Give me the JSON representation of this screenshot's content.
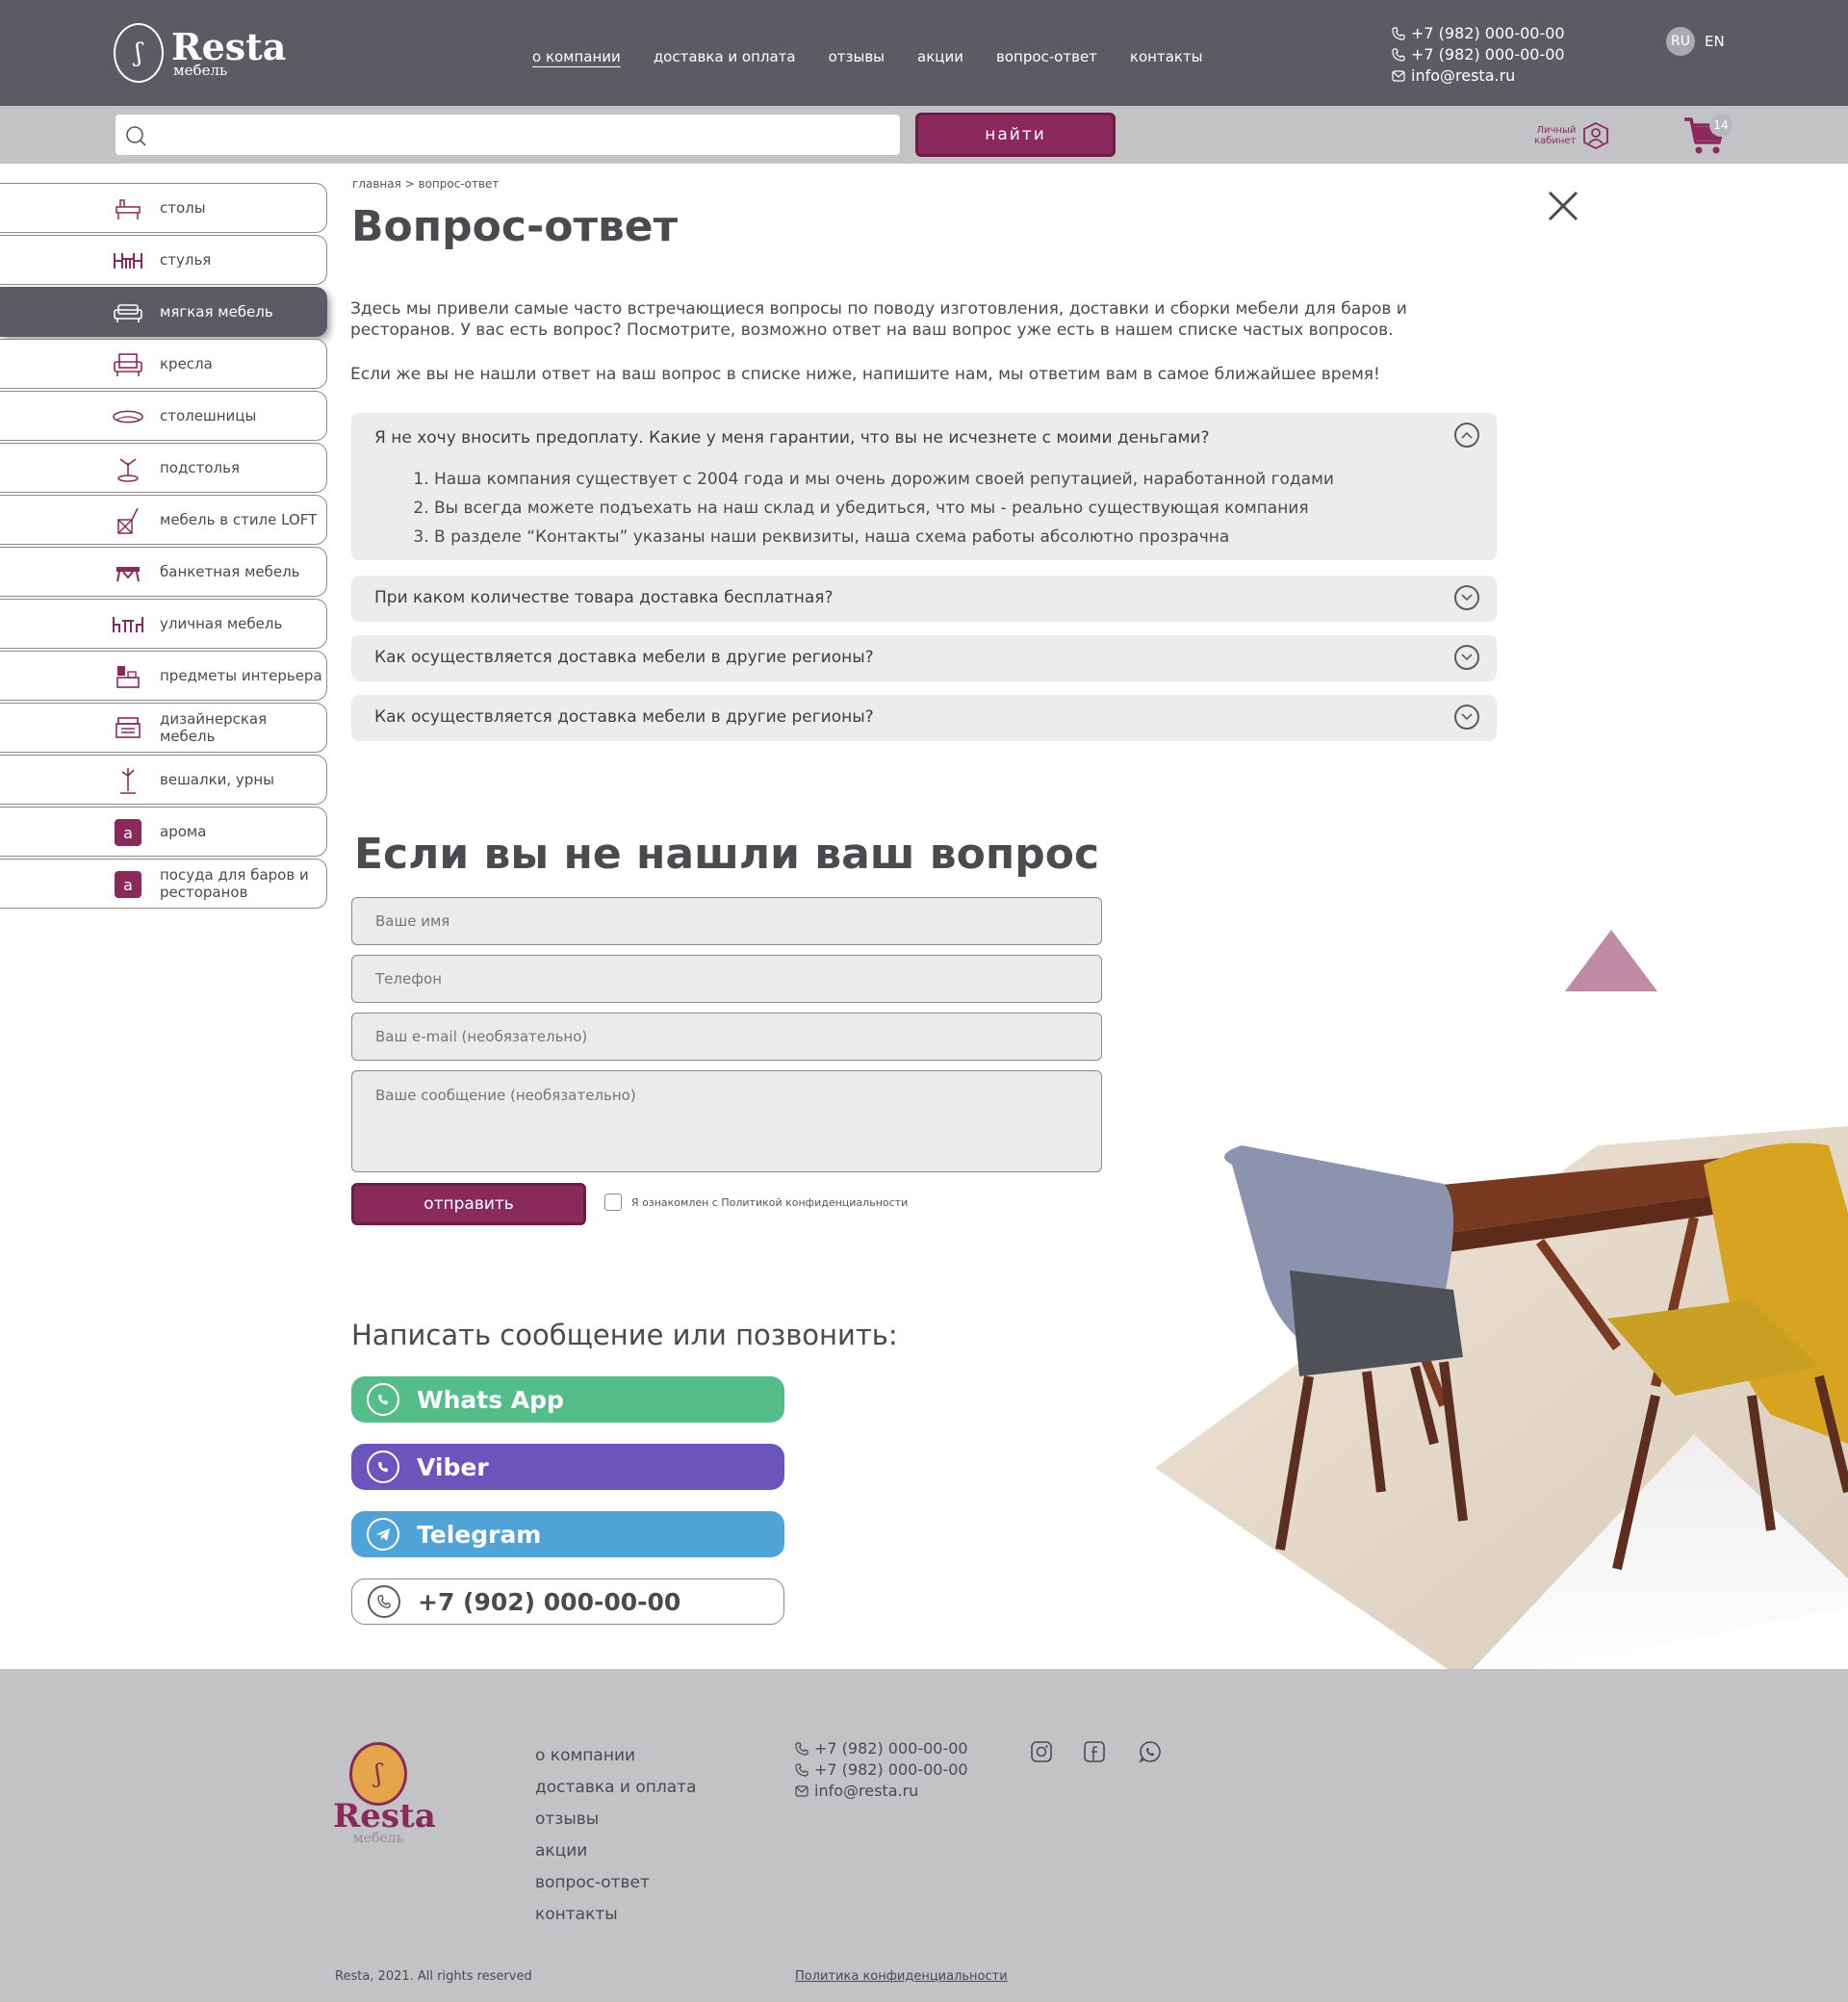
{
  "header": {
    "logo_name": "Resta",
    "logo_sub": "мебель",
    "nav": [
      "о компании",
      "доставка и оплата",
      "отзывы",
      "акции",
      "вопрос-ответ",
      "контакты"
    ],
    "phone1": "+7 (982) 000-00-00",
    "phone2": "+7 (982) 000-00-00",
    "email": "info@resta.ru",
    "lang_ru": "RU",
    "lang_en": "EN"
  },
  "search": {
    "placeholder": "",
    "button_label": "найти",
    "cabinet_label_1": "Личный",
    "cabinet_label_2": "кабинет",
    "cart_count": "14"
  },
  "sidebar": {
    "items": [
      {
        "label": "столы",
        "icon": "table-icon"
      },
      {
        "label": "стулья",
        "icon": "chairs-icon"
      },
      {
        "label": "мягкая мебель",
        "icon": "sofa-icon",
        "active": true
      },
      {
        "label": "кресла",
        "icon": "armchair-icon"
      },
      {
        "label": "столешницы",
        "icon": "tabletop-icon"
      },
      {
        "label": "подстолья",
        "icon": "table-base-icon"
      },
      {
        "label": "мебель в стиле LOFT",
        "icon": "loft-icon"
      },
      {
        "label": "банкетная мебель",
        "icon": "banquet-icon"
      },
      {
        "label": "уличная мебель",
        "icon": "outdoor-icon"
      },
      {
        "label": "предметы интерьера",
        "icon": "interior-icon"
      },
      {
        "label": "дизайнерская мебель",
        "icon": "designer-icon"
      },
      {
        "label": "вешалки, урны",
        "icon": "hanger-icon"
      },
      {
        "label": "арома",
        "icon": "a-badge-icon",
        "badge": "a"
      },
      {
        "label": "посуда для баров и ресторанов",
        "icon": "a-badge-icon",
        "badge": "a"
      }
    ]
  },
  "main": {
    "breadcrumb": "главная > вопрос-ответ",
    "title": "Вопрос-ответ",
    "intro": "Здесь мы привели самые часто встречающиеся вопросы по поводу изготовления, доставки и сборки мебели для баров и ресторанов. У вас есть вопрос? Посмотрите, возможно ответ на ваш вопрос уже есть в нашем списке частых вопросов.",
    "intro2": "Если же вы не нашли ответ на ваш вопрос в списке ниже, напишите нам, мы ответим вам в самое ближайшее время!",
    "faq": [
      {
        "question": "Я не хочу вносить предоплату. Какие у меня гарантии, что вы не исчезнете с моими деньгами?",
        "expanded": true,
        "answers": [
          "Наша компания существует с 2004 года и мы очень дорожим своей репутацией, наработанной годами",
          "Вы всегда можете подъехать на наш склад и убедиться, что мы - реально существующая компания",
          "В разделе “Контакты” указаны наши реквизиты, наша схема работы абсолютно прозрачна"
        ]
      },
      {
        "question": "При каком количестве товара доставка бесплатная?",
        "expanded": false
      },
      {
        "question": "Как осуществляется доставка мебели в другие регионы?",
        "expanded": false
      },
      {
        "question": "Как осуществляется доставка мебели в другие регионы?",
        "expanded": false
      }
    ]
  },
  "form": {
    "title": "Если вы не нашли ваш вопрос",
    "name_placeholder": "Ваше имя",
    "phone_placeholder": "Телефон",
    "email_placeholder": "Ваш e-mail (необязательно)",
    "message_placeholder": "Ваше сообщение (необязательно)",
    "submit_label": "отправить",
    "consent_label": "Я ознакомлен с Политикой конфиденциальности"
  },
  "contact": {
    "title": "Написать сообщение или позвонить:",
    "whatsapp_label": "Whats App",
    "viber_label": "Viber",
    "telegram_label": "Telegram",
    "phone_label": "+7 (902) 000-00-00",
    "colors": {
      "whatsapp": "#55bd8a",
      "viber": "#6a55bd",
      "telegram": "#4fa3d6"
    }
  },
  "footer": {
    "logo_name": "Resta",
    "logo_sub": "мебель",
    "nav": [
      "о компании",
      "доставка и оплата",
      "отзывы",
      "акции",
      "вопрос-ответ",
      "контакты"
    ],
    "phone1": "+7 (982) 000-00-00",
    "phone2": "+7 (982) 000-00-00",
    "email": "info@resta.ru",
    "copyright": "Resta, 2021. All rights reserved",
    "privacy": "Политика конфиденциальности"
  },
  "colors": {
    "brand": "#8a2a5c",
    "header_bg": "#5c5a63",
    "bar_bg": "#c3c3c6",
    "faq_bg": "#ececed"
  }
}
